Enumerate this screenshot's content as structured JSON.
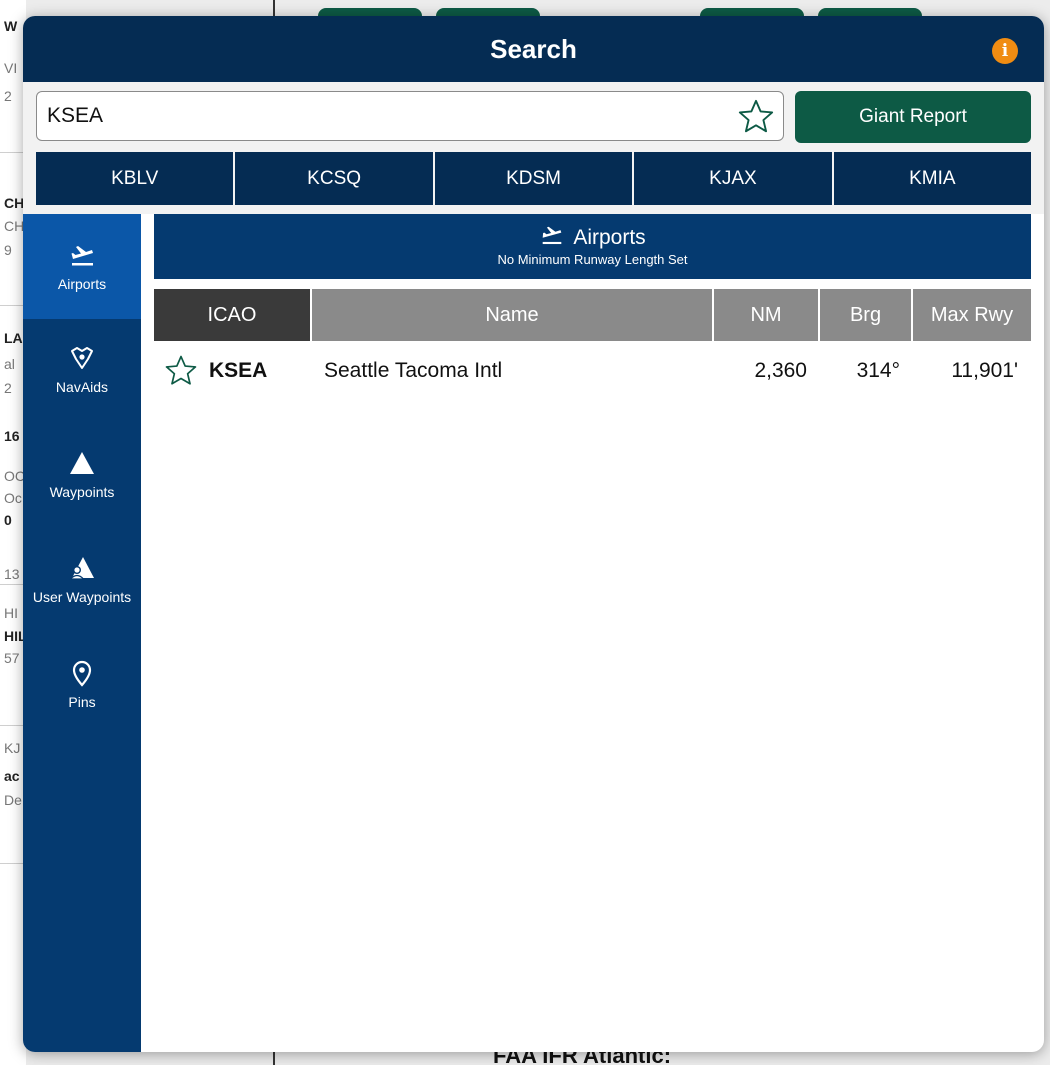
{
  "modal": {
    "title": "Search",
    "info_icon": "info-icon",
    "info_glyph": "i",
    "accent_color": "#f08c12"
  },
  "search": {
    "value": "KSEA",
    "favorite_icon": "star-outline-icon",
    "giant_report_label": "Giant Report"
  },
  "recent_airports": [
    "KBLV",
    "KCSQ",
    "KDSM",
    "KJAX",
    "KMIA"
  ],
  "sidebar": {
    "items": [
      {
        "label": "Airports",
        "icon": "airplane-departure-icon",
        "active": true
      },
      {
        "label": "NavAids",
        "icon": "navaid-icon",
        "active": false
      },
      {
        "label": "Waypoints",
        "icon": "triangle-icon",
        "active": false
      },
      {
        "label": "User Waypoints",
        "icon": "user-waypoint-icon",
        "active": false
      },
      {
        "label": "Pins",
        "icon": "pin-icon",
        "active": false
      }
    ]
  },
  "category": {
    "title": "Airports",
    "subtitle": "No Minimum Runway Length Set"
  },
  "table": {
    "columns": [
      "ICAO",
      "Name",
      "NM",
      "Brg",
      "Max Rwy"
    ],
    "rows": [
      {
        "icao": "KSEA",
        "name": "Seattle Tacoma Intl",
        "nm": "2,360",
        "brg": "314°",
        "max_rwy": "11,901'"
      }
    ]
  },
  "background": {
    "bottom_text": "FAA IFR Atlantic:",
    "edge_letters": [
      "W",
      "VI",
      "2",
      "CH",
      "CH",
      "9",
      "LA",
      "al",
      "2",
      "16",
      "OC",
      "Oc",
      "0",
      "13",
      "HI",
      "HIL",
      "57",
      "KJ",
      "ac",
      "De"
    ]
  },
  "colors": {
    "header": "#052c53",
    "sidebar": "#053a70",
    "sidebar_active": "#0b57a8",
    "report_button": "#0d5a45",
    "table_header": "#8a8a8a",
    "table_header_active": "#3a3a3a"
  }
}
